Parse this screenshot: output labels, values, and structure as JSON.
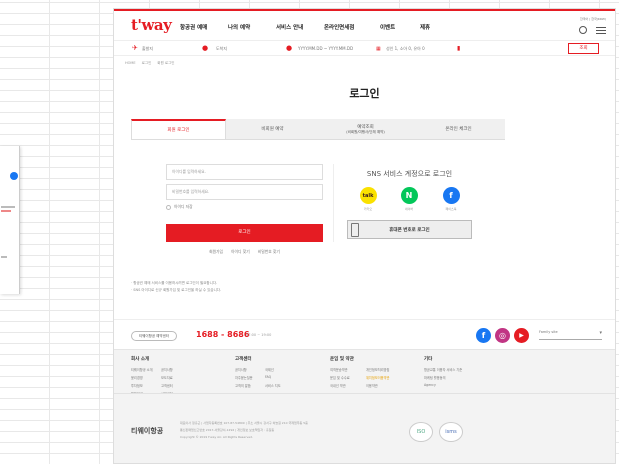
{
  "header": {
    "logo": "t'way",
    "nav": [
      "항공권 예매",
      "나의 예약",
      "서비스 안내",
      "온라인면세점",
      "이벤트",
      "제휴"
    ],
    "util": "한국어 | 한국(KRW)"
  },
  "booking": {
    "from": "출발지",
    "to": "도착지",
    "dates": "YYYY.MM.DD ~ YYYY.MM.DD",
    "pax": "성인 1, 소아 0, 유아 0",
    "search": "조회"
  },
  "breadcrumb": [
    "HOME",
    "로그인",
    "회원 로그인"
  ],
  "page_title": "로그인",
  "tabs": [
    {
      "label": "회원 로그인",
      "sub": ""
    },
    {
      "label": "비회원 예약",
      "sub": ""
    },
    {
      "label": "예약조회",
      "sub": "(비회원/여행사/단체 예약)"
    },
    {
      "label": "온라인 체크인",
      "sub": ""
    }
  ],
  "login": {
    "id_placeholder": "아이디를 입력하세요.",
    "pw_placeholder": "비밀번호를 입력하세요.",
    "save_id": "아이디 저장",
    "button": "로그인",
    "links": [
      "회원가입",
      "아이디 찾기",
      "비밀번호 찾기"
    ]
  },
  "sns": {
    "title": "SNS 서비스 계정으로 로그인",
    "items": [
      {
        "name": "kakao",
        "label": "카카오",
        "color": "#fae100"
      },
      {
        "name": "naver",
        "label": "네이버",
        "color": "#03c75a"
      },
      {
        "name": "facebook",
        "label": "페이스북",
        "color": "#1877f2"
      }
    ],
    "phone_login": "휴대폰 번호로 로그인"
  },
  "notes": [
    "· 항공권 예매 서비스를 이용하시려면 로그인이 필요합니다.",
    "· SNS 아이디로 신규 회원가입 및 로그인을 하실 수 있습니다."
  ],
  "contact": {
    "button": "티웨이항공 예약센터",
    "number": "1688 - 8686",
    "hours": "07:00 ~ 19:00",
    "family_site": "Family site"
  },
  "footer": {
    "cols": [
      {
        "title": "회사 소개",
        "items": [
          "티웨이항공 소개",
          "윤리경영",
          "투자정보",
          "채용안내",
          "공지사항",
          "보도자료",
          "고객센터",
          "사회공헌"
        ]
      },
      {
        "title": "고객센터",
        "items": [
          "공지사항",
          "자주묻는질문",
          "고객의 말씀",
          "국제선",
          "FAQ",
          "서비스 지도"
        ]
      },
      {
        "title": "운임 및 약관",
        "items": [
          "여객운송약관",
          "운임 및 수수료",
          "개인정보처리방침",
          "국내선 약관",
          "위치정보이용약관",
          "이용약관"
        ]
      },
      {
        "title": "기타",
        "items": [
          "항공교통 이용자 서비스 기준",
          "마케팅 활용동의",
          "Agency"
        ]
      }
    ],
    "logo": "티웨이항공",
    "info": [
      "대표이사 정홍근 | 사업자등록번호 107-87-54809 | 주소 서울시 강서구 하늘길 210 국제업무동 5층",
      "통신판매업신고번호 2017-서울강서-1292 | 개인정보 보호책임자 : 홍길동",
      "Copyright © 2019 t'way Air. All Rights Reserved."
    ],
    "badges": [
      "ISO",
      "isms"
    ]
  }
}
